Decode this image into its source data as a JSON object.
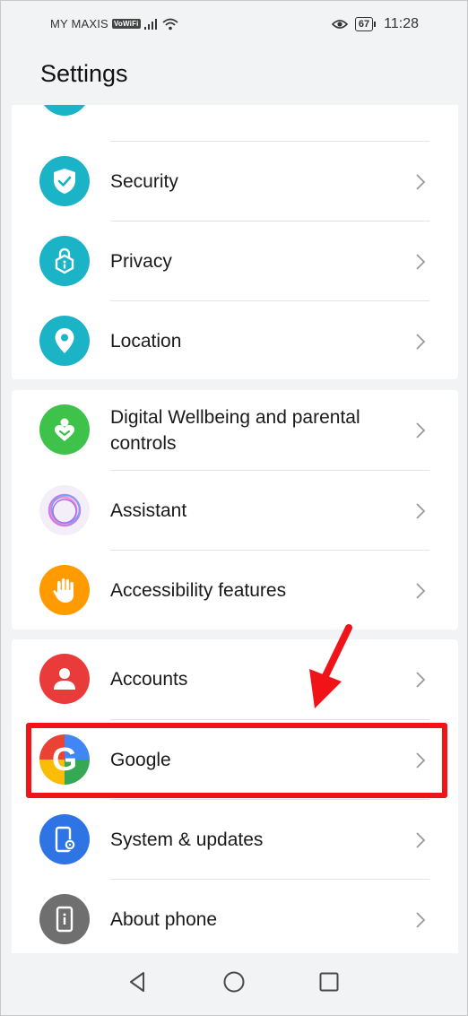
{
  "status_bar": {
    "carrier": "MY MAXIS",
    "vowifi": "VoWiFi",
    "battery": "67",
    "time": "11:28"
  },
  "header": {
    "title": "Settings"
  },
  "groups": [
    {
      "items": [
        {
          "label": "Security",
          "icon": "shield-check-icon",
          "color": "#1bb3c6"
        },
        {
          "label": "Privacy",
          "icon": "lock-info-icon",
          "color": "#1bb3c6"
        },
        {
          "label": "Location",
          "icon": "location-pin-icon",
          "color": "#1bb3c6"
        }
      ]
    },
    {
      "items": [
        {
          "label": "Digital Wellbeing and parental controls",
          "icon": "wellbeing-heart-icon",
          "color": "#3ec24a"
        },
        {
          "label": "Assistant",
          "icon": "assistant-orb-icon",
          "color": "#ffffff"
        },
        {
          "label": "Accessibility features",
          "icon": "hand-icon",
          "color": "#ff9a00"
        }
      ]
    },
    {
      "items": [
        {
          "label": "Accounts",
          "icon": "person-icon",
          "color": "#ea3b3b"
        },
        {
          "label": "Google",
          "icon": "google-g-icon",
          "color": "#ffffff"
        },
        {
          "label": "System & updates",
          "icon": "phone-gear-icon",
          "color": "#2f74e4"
        },
        {
          "label": "About phone",
          "icon": "phone-info-icon",
          "color": "#6f6f6f"
        }
      ]
    }
  ],
  "annotation": {
    "color": "#f01418",
    "highlighted_item": "Google"
  }
}
